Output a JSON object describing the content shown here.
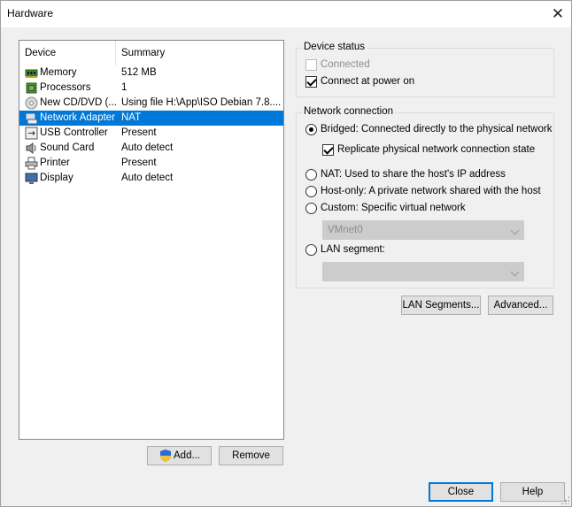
{
  "window": {
    "title": "Hardware"
  },
  "device_list": {
    "columns": [
      "Device",
      "Summary"
    ],
    "rows": [
      {
        "name": "Memory",
        "summary": "512 MB",
        "icon": "memory-icon",
        "selected": false
      },
      {
        "name": "Processors",
        "summary": "1",
        "icon": "processor-icon",
        "selected": false
      },
      {
        "name": "New CD/DVD (...",
        "summary": "Using file H:\\App\\ISO Debian 7.8....",
        "icon": "cd-dvd-icon",
        "selected": false
      },
      {
        "name": "Network Adapter",
        "summary": "NAT",
        "icon": "network-adapter-icon",
        "selected": true
      },
      {
        "name": "USB Controller",
        "summary": "Present",
        "icon": "usb-controller-icon",
        "selected": false
      },
      {
        "name": "Sound Card",
        "summary": "Auto detect",
        "icon": "sound-card-icon",
        "selected": false
      },
      {
        "name": "Printer",
        "summary": "Present",
        "icon": "printer-icon",
        "selected": false
      },
      {
        "name": "Display",
        "summary": "Auto detect",
        "icon": "display-icon",
        "selected": false
      }
    ],
    "add_label": "Add...",
    "remove_label": "Remove"
  },
  "device_status": {
    "title": "Device status",
    "connected": {
      "label": "Connected",
      "checked": false,
      "enabled": false
    },
    "connect_at_power_on": {
      "label": "Connect at power on",
      "checked": true,
      "enabled": true
    }
  },
  "network_connection": {
    "title": "Network connection",
    "bridged": {
      "label": "Bridged: Connected directly to the physical network",
      "checked": true
    },
    "replicate": {
      "label": "Replicate physical network connection state",
      "checked": true
    },
    "nat": {
      "label": "NAT: Used to share the host's IP address",
      "checked": false
    },
    "host_only": {
      "label": "Host-only: A private network shared with the host",
      "checked": false
    },
    "custom": {
      "label": "Custom: Specific virtual network",
      "checked": false
    },
    "custom_value": "VMnet0",
    "lan_segment": {
      "label": "LAN segment:",
      "checked": false
    },
    "lan_segment_value": ""
  },
  "buttons": {
    "lan_segments": "LAN Segments...",
    "advanced": "Advanced...",
    "close": "Close",
    "help": "Help"
  },
  "colors": {
    "selection": "#0078d7",
    "window_bg": "#f0f0f0"
  }
}
